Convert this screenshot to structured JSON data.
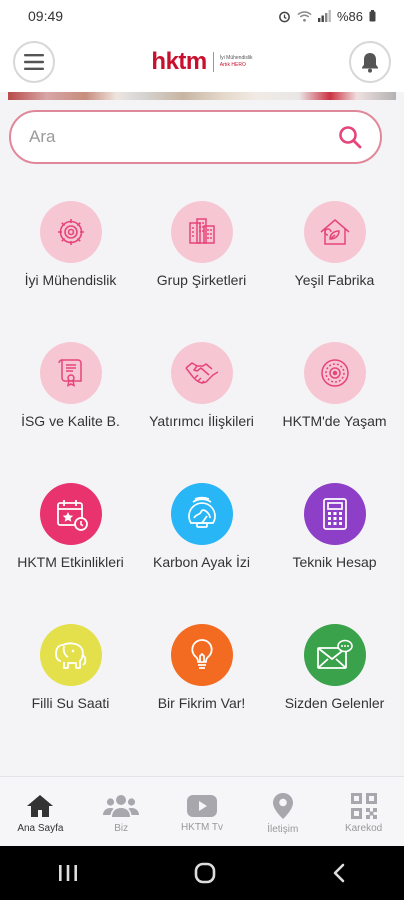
{
  "status_bar": {
    "time": "09:49",
    "battery": "%86"
  },
  "header": {
    "logo_text": "hktm",
    "logo_subtitle_1": "İyi Mühendislik",
    "logo_subtitle_2": "Artık HERO"
  },
  "search": {
    "placeholder": "Ara"
  },
  "grid": {
    "items": [
      {
        "label": "İyi Mühendislik",
        "icon": "gear-icon"
      },
      {
        "label": "Grup Şirketleri",
        "icon": "buildings-icon"
      },
      {
        "label": "Yeşil Fabrika",
        "icon": "eco-factory-icon"
      },
      {
        "label": "İSG ve Kalite B.",
        "icon": "certificate-icon"
      },
      {
        "label": "Yatırımcı İlişkileri",
        "icon": "handshake-icon"
      },
      {
        "label": "HKTM'de Yaşam",
        "icon": "target-icon"
      },
      {
        "label": "HKTM Etkinlikleri",
        "icon": "calendar-star-icon"
      },
      {
        "label": "Karbon Ayak İzi",
        "icon": "globe-gauge-icon"
      },
      {
        "label": "Teknik Hesap",
        "icon": "calculator-icon"
      },
      {
        "label": "Filli Su Saati",
        "icon": "elephant-icon"
      },
      {
        "label": "Bir Fikrim Var!",
        "icon": "lightbulb-icon"
      },
      {
        "label": "Sizden Gelenler",
        "icon": "envelope-chat-icon"
      }
    ]
  },
  "colors": {
    "accent": "#e5457a",
    "soft_pink": "#f6c7d3",
    "magenta": "#e8336e",
    "cyan": "#29b6f6",
    "purple": "#8e3fc8",
    "yellow": "#e3e04b",
    "orange": "#f26b21",
    "green": "#3aa24a"
  },
  "bottom_nav": {
    "items": [
      {
        "label": "Ana Sayfa",
        "icon": "home-icon",
        "active": true
      },
      {
        "label": "Biz",
        "icon": "group-icon",
        "active": false
      },
      {
        "label": "HKTM Tv",
        "icon": "play-icon",
        "active": false
      },
      {
        "label": "İletişim",
        "icon": "location-pin-icon",
        "active": false
      },
      {
        "label": "Karekod",
        "icon": "qr-code-icon",
        "active": false
      }
    ]
  }
}
